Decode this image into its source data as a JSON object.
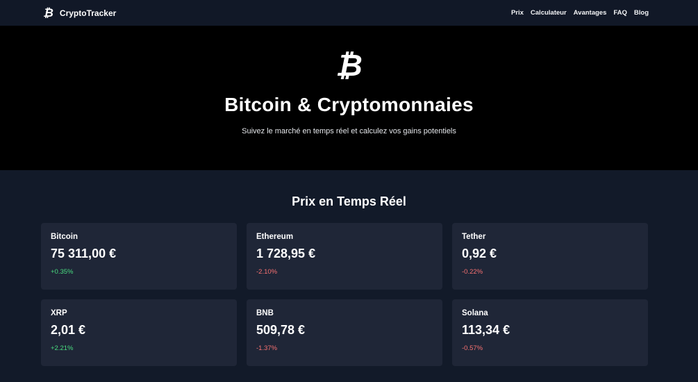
{
  "navbar": {
    "brand_icon": "₿",
    "brand_name": "CryptoTracker",
    "links": [
      "Prix",
      "Calculateur",
      "Avantages",
      "FAQ",
      "Blog"
    ]
  },
  "hero": {
    "icon": "₿",
    "title": "Bitcoin & Cryptomonnaies",
    "subtitle": "Suivez le marché en temps réel et calculez vos gains potentiels"
  },
  "prices": {
    "title": "Prix en Temps Réel",
    "cards": [
      {
        "name": "Bitcoin",
        "price": "75 311,00 €",
        "change": "+0.35%",
        "trend": "up"
      },
      {
        "name": "Ethereum",
        "price": "1 728,95 €",
        "change": "-2.10%",
        "trend": "down"
      },
      {
        "name": "Tether",
        "price": "0,92 €",
        "change": "-0.22%",
        "trend": "down"
      },
      {
        "name": "XRP",
        "price": "2,01 €",
        "change": "+2.21%",
        "trend": "up"
      },
      {
        "name": "BNB",
        "price": "509,78 €",
        "change": "-1.37%",
        "trend": "down"
      },
      {
        "name": "Solana",
        "price": "113,34 €",
        "change": "-0.57%",
        "trend": "down"
      }
    ]
  },
  "colors": {
    "positive": "#4ade80",
    "negative": "#f87171",
    "card_bg": "#1f2637",
    "page_bg": "#121a29"
  }
}
